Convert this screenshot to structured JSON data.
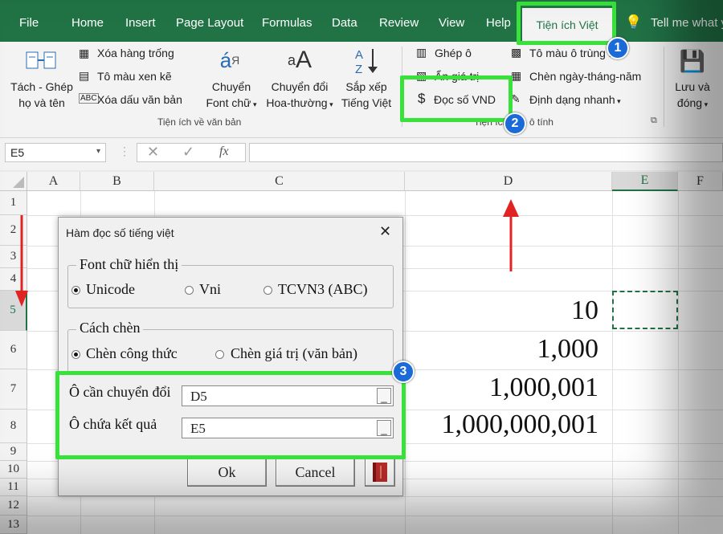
{
  "tabs": [
    "File",
    "Home",
    "Insert",
    "Page Layout",
    "Formulas",
    "Data",
    "Review",
    "View",
    "Help"
  ],
  "active_tab": "Tiện ích Việt",
  "tell_me": "Tell me what y",
  "ribbon": {
    "tach_ghep_1": "Tách - Ghép",
    "tach_ghep_2": "họ và tên",
    "xoa_hang_trong": "Xóa hàng trống",
    "to_mau_xen_ke": "Tô màu xen kẽ",
    "xoa_dau": "Xóa dấu văn bản",
    "chuyen_font_1": "Chuyển",
    "chuyen_font_2": "Font chữ",
    "chuyen_doi_1": "Chuyển đổi",
    "chuyen_doi_2": "Hoa-thường",
    "sap_xep_1": "Sắp xếp",
    "sap_xep_2": "Tiếng Việt",
    "group_text": "Tiện ích về văn bản",
    "ghep_o": "Ghép ô",
    "an_gia_tri": "Ẩn giá trị",
    "doc_so_vnd": "Đọc số VND",
    "to_mau_trung": "Tô màu ô trùng lặp",
    "chen_ngay": "Chèn ngày-tháng-năm",
    "dinh_dang": "Định dạng nhanh",
    "group_cell": "Tiện ích số - ô tính",
    "luu_va_1": "Lưu và",
    "luu_va_2": "đóng"
  },
  "name_box": "E5",
  "fx_label": "fx",
  "columns": [
    "A",
    "B",
    "C",
    "D",
    "E",
    "F"
  ],
  "rows": [
    "1",
    "2",
    "3",
    "4",
    "5",
    "6",
    "7",
    "8",
    "9",
    "10",
    "11",
    "12",
    "13"
  ],
  "cells": {
    "d5": "10",
    "d6": "1,000",
    "d7": "1,000,001",
    "d8": "1,000,000,001"
  },
  "dialog": {
    "title": "Hàm đọc số tiếng việt",
    "close": "✕",
    "font_group": "Font chữ hiển thị",
    "font_options": [
      "Unicode",
      "Vni",
      "TCVN3 (ABC)"
    ],
    "insert_group": "Cách chèn",
    "insert_options": [
      "Chèn công thức",
      "Chèn giá trị (văn bản)"
    ],
    "source_label": "Ô cần chuyển đổi",
    "source_value": "D5",
    "result_label": "Ô chứa kết quả",
    "result_value": "E5",
    "ok": "Ok",
    "cancel": "Cancel"
  },
  "badges": [
    "1",
    "2",
    "3"
  ],
  "colors": {
    "excel_green": "#217346",
    "highlight": "#38e23b",
    "badge": "#1a6bd8",
    "arrow": "#e02424"
  }
}
